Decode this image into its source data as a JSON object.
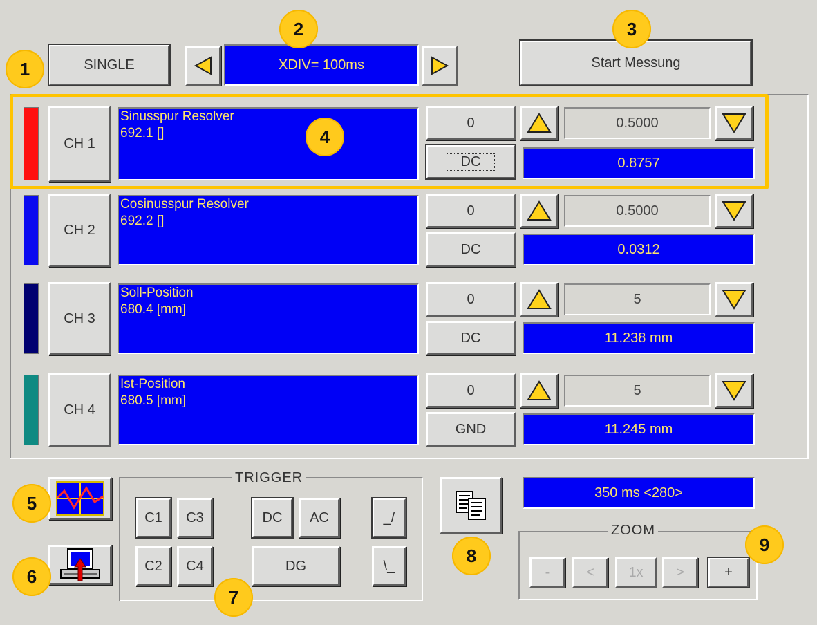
{
  "header": {
    "mode_label": "SINGLE",
    "xdiv_value": "XDIV= 100ms",
    "start_label": "Start Messung"
  },
  "channels": [
    {
      "button": "CH 1",
      "color": "#ff1010",
      "name": "Sinusspur Resolver",
      "id": "692.1 []",
      "offset": "0",
      "coupling": "DC",
      "scale": "0.5000",
      "value": "0.8757"
    },
    {
      "button": "CH 2",
      "color": "#0a0af0",
      "name": "Cosinusspur Resolver",
      "id": "692.2 []",
      "offset": "0",
      "coupling": "DC",
      "scale": "0.5000",
      "value": "0.0312"
    },
    {
      "button": "CH 3",
      "color": "#000070",
      "name": "Soll-Position",
      "id": "680.4 [mm]",
      "offset": "0",
      "coupling": "DC",
      "scale": "5",
      "value": "11.238 mm"
    },
    {
      "button": "CH 4",
      "color": "#0f8a82",
      "name": "Ist-Position",
      "id": "680.5 [mm]",
      "offset": "0",
      "coupling": "GND",
      "scale": "5",
      "value": "11.245 mm"
    }
  ],
  "trigger": {
    "title": "TRIGGER",
    "c1": "C1",
    "c2": "C2",
    "c3": "C3",
    "c4": "C4",
    "dc": "DC",
    "ac": "AC",
    "dg": "DG",
    "rising": "_/",
    "falling": "\\_"
  },
  "time_display": "350 ms <280>",
  "zoom": {
    "title": "ZOOM",
    "minus": "-",
    "left": "<",
    "one": "1x",
    "right": ">",
    "plus": "+"
  },
  "badges": [
    "1",
    "2",
    "3",
    "4",
    "5",
    "6",
    "7",
    "8",
    "9"
  ],
  "icons": {
    "left_arrow": "triangle-left-icon",
    "right_arrow": "triangle-right-icon",
    "up_arrow": "triangle-up-icon",
    "down_arrow": "triangle-down-icon",
    "scope": "oscilloscope-icon",
    "computer": "computer-upload-icon",
    "copy": "copy-documents-icon"
  },
  "colors": {
    "panel_bg": "#d8d7d2",
    "display_blue": "#0000f6",
    "display_text": "#fbe36c",
    "badge_yellow": "#ffca1c",
    "highlight_frame": "#ffc400"
  }
}
